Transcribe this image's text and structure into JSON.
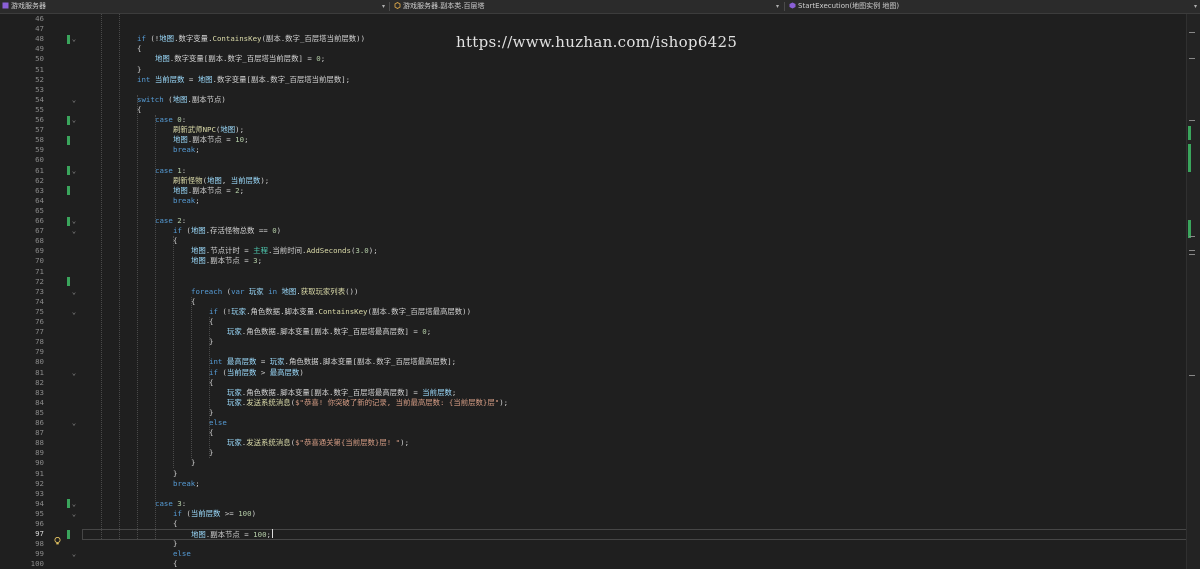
{
  "navbar": {
    "project": "游戏服务器",
    "class": "游戏服务器.副本类.百层塔",
    "member": "StartExecution(地图实例 地图)"
  },
  "watermark": "https://www.huzhan.com/ishop6425",
  "colors": {
    "keyword": "#569cd6",
    "text": "#d4d4d4",
    "string": "#d69d85",
    "number": "#b5cea8",
    "member": "#dcdcaa",
    "local": "#9cdcfe",
    "type": "#4ec9b0",
    "change_marker": "#3aa55c"
  },
  "editor": {
    "current_line": 97,
    "lines": [
      {
        "n": "46",
        "code": ""
      },
      {
        "n": "47",
        "code": ""
      },
      {
        "n": "48",
        "code": "    if (!地图.数字变量.ContainsKey(副本.数字_百层塔当前层数))"
      },
      {
        "n": "49",
        "code": "    {"
      },
      {
        "n": "50",
        "code": "        地图.数字变量[副本.数字_百层塔当前层数] = 0;"
      },
      {
        "n": "51",
        "code": "    }"
      },
      {
        "n": "52",
        "code": "    int 当前层数 = 地图.数字变量[副本.数字_百层塔当前层数];"
      },
      {
        "n": "53",
        "code": ""
      },
      {
        "n": "54",
        "code": "    switch (地图.副本节点)"
      },
      {
        "n": "55",
        "code": "    {"
      },
      {
        "n": "56",
        "code": "        case 0:"
      },
      {
        "n": "57",
        "code": "            刷新武师NPC(地图);"
      },
      {
        "n": "58",
        "code": "            地图.副本节点 = 10;"
      },
      {
        "n": "59",
        "code": "            break;"
      },
      {
        "n": "60",
        "code": ""
      },
      {
        "n": "61",
        "code": "        case 1:"
      },
      {
        "n": "62",
        "code": "            刷新怪物(地图, 当前层数);"
      },
      {
        "n": "63",
        "code": "            地图.副本节点 = 2;"
      },
      {
        "n": "64",
        "code": "            break;"
      },
      {
        "n": "65",
        "code": ""
      },
      {
        "n": "66",
        "code": "        case 2:"
      },
      {
        "n": "67",
        "code": "            if (地图.存活怪物总数 == 0)"
      },
      {
        "n": "68",
        "code": "            {"
      },
      {
        "n": "69",
        "code": "                地图.节点计时 = 主程.当前时间.AddSeconds(3.0);"
      },
      {
        "n": "70",
        "code": "                地图.副本节点 = 3;"
      },
      {
        "n": "71",
        "code": ""
      },
      {
        "n": "72",
        "code": ""
      },
      {
        "n": "73",
        "code": "                foreach (var 玩家 in 地图.获取玩家列表())"
      },
      {
        "n": "74",
        "code": "                {"
      },
      {
        "n": "75",
        "code": "                    if (!玩家.角色数据.脚本变量.ContainsKey(副本.数字_百层塔最高层数))"
      },
      {
        "n": "76",
        "code": "                    {"
      },
      {
        "n": "77",
        "code": "                        玩家.角色数据.脚本变量[副本.数字_百层塔最高层数] = 0;"
      },
      {
        "n": "78",
        "code": "                    }"
      },
      {
        "n": "79",
        "code": ""
      },
      {
        "n": "80",
        "code": "                    int 最高层数 = 玩家.角色数据.脚本变量[副本.数字_百层塔最高层数];"
      },
      {
        "n": "81",
        "code": "                    if (当前层数 > 最高层数)"
      },
      {
        "n": "82",
        "code": "                    {"
      },
      {
        "n": "83",
        "code": "                        玩家.角色数据.脚本变量[副本.数字_百层塔最高层数] = 当前层数;"
      },
      {
        "n": "84",
        "code": "                        玩家.发送系统消息($\"恭喜! 你突破了新的记录, 当前最高层数: {当前层数}层\");"
      },
      {
        "n": "85",
        "code": "                    }"
      },
      {
        "n": "86",
        "code": "                    else"
      },
      {
        "n": "87",
        "code": "                    {"
      },
      {
        "n": "88",
        "code": "                        玩家.发送系统消息($\"恭喜通关第{当前层数}层! \");"
      },
      {
        "n": "89",
        "code": "                    }"
      },
      {
        "n": "90",
        "code": "                }"
      },
      {
        "n": "91",
        "code": "            }"
      },
      {
        "n": "92",
        "code": "            break;"
      },
      {
        "n": "93",
        "code": ""
      },
      {
        "n": "94",
        "code": "        case 3:"
      },
      {
        "n": "95",
        "code": "            if (当前层数 >= 100)"
      },
      {
        "n": "96",
        "code": "            {"
      },
      {
        "n": "97",
        "code": "                地图.副本节点 = 100;"
      },
      {
        "n": "98",
        "code": "            }"
      },
      {
        "n": "99",
        "code": "            else"
      },
      {
        "n": "100",
        "code": "            {"
      }
    ]
  }
}
